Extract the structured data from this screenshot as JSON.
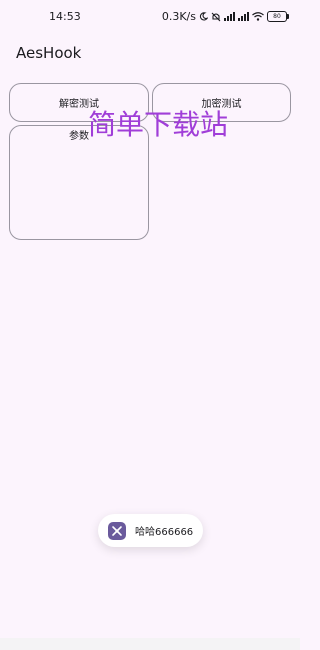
{
  "status_bar": {
    "time": "14:53",
    "speed": "0.3K/s",
    "battery": "80",
    "icons": [
      "moon-icon",
      "mute-icon",
      "signal-icon",
      "signal-icon",
      "wifi-icon",
      "battery-icon"
    ]
  },
  "app": {
    "title": "AesHook"
  },
  "buttons": {
    "decrypt_label": "解密测试",
    "encrypt_label": "加密测试"
  },
  "params": {
    "label": "参数",
    "value": ""
  },
  "watermark": {
    "text": "简单下载站",
    "color": "#a03ed8"
  },
  "toast": {
    "text": "哈哈666666",
    "icon": "app-icon"
  },
  "colors": {
    "background": "#fcf4fd",
    "outline": "#9a96a1"
  }
}
